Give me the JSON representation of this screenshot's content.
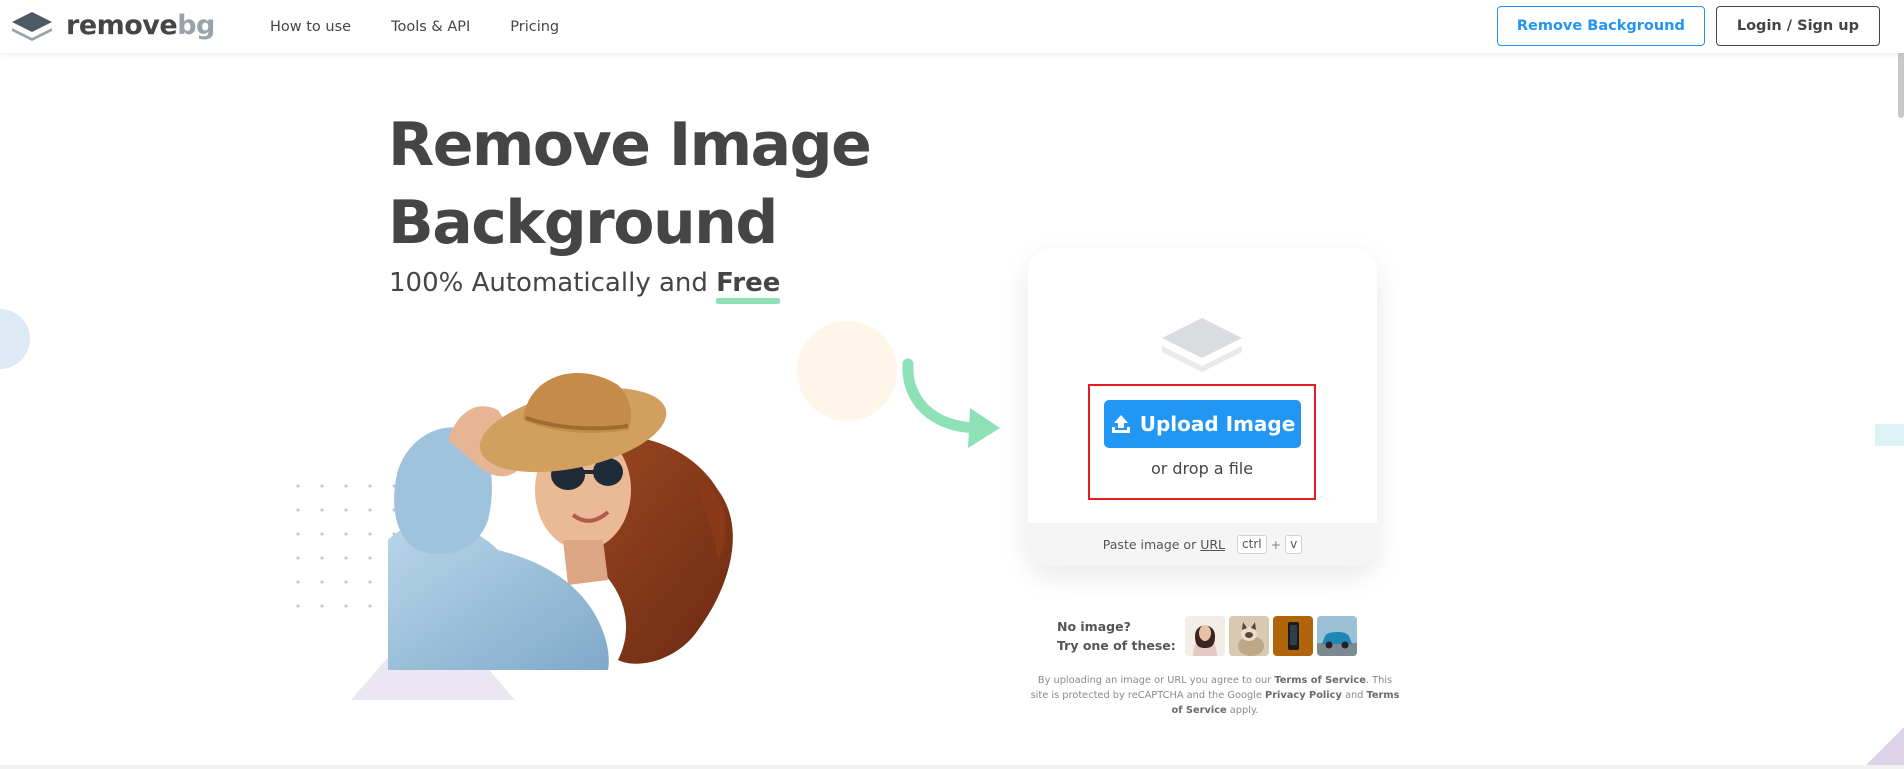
{
  "brand": {
    "logo_word1": "remove",
    "logo_word2": "bg"
  },
  "nav": {
    "links": [
      "How to use",
      "Tools & API",
      "Pricing"
    ],
    "remove_background_label": "Remove Background",
    "login_label": "Login / Sign up"
  },
  "hero": {
    "title_line1": "Remove Image",
    "title_line2": "Background",
    "subtitle_prefix": "100% Automatically and ",
    "subtitle_emphasis": "Free"
  },
  "upload": {
    "button_label": "Upload Image",
    "drop_text": "or drop a file",
    "paste_prefix": "Paste image or",
    "paste_url": "URL",
    "key_ctrl": "ctrl",
    "key_plus": "+",
    "key_v": "v"
  },
  "samples": {
    "label_line1": "No image?",
    "label_line2": "Try one of these:"
  },
  "legal": {
    "part1": "By uploading an image or URL you agree to our ",
    "tos1": "Terms of Service",
    "part2": ". This site is protected by reCAPTCHA and the Google ",
    "privacy": "Privacy Policy",
    "part3": " and ",
    "tos2": "Terms of Service",
    "part4": " apply."
  },
  "colors": {
    "accent_blue": "#2196f3",
    "text_dark": "#454545",
    "highlight_green": "#8ee0b6",
    "frame_red": "#e01e24"
  },
  "icons": {
    "logo": "layers-logo-icon",
    "upload": "upload-icon",
    "card": "layers-icon",
    "arrow": "curved-arrow-icon"
  }
}
